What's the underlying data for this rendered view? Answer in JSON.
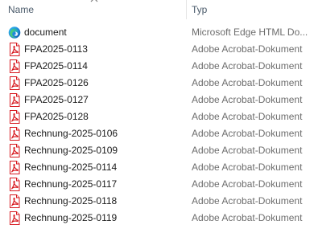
{
  "columns": {
    "name": "Name",
    "type": "Typ"
  },
  "files": [
    {
      "name": "document",
      "type": "Microsoft Edge HTML Do...",
      "icon": "edge-icon"
    },
    {
      "name": "FPA2025-0113",
      "type": "Adobe Acrobat-Dokument",
      "icon": "pdf-icon"
    },
    {
      "name": "FPA2025-0114",
      "type": "Adobe Acrobat-Dokument",
      "icon": "pdf-icon"
    },
    {
      "name": "FPA2025-0126",
      "type": "Adobe Acrobat-Dokument",
      "icon": "pdf-icon"
    },
    {
      "name": "FPA2025-0127",
      "type": "Adobe Acrobat-Dokument",
      "icon": "pdf-icon"
    },
    {
      "name": "FPA2025-0128",
      "type": "Adobe Acrobat-Dokument",
      "icon": "pdf-icon"
    },
    {
      "name": "Rechnung-2025-0106",
      "type": "Adobe Acrobat-Dokument",
      "icon": "pdf-icon"
    },
    {
      "name": "Rechnung-2025-0109",
      "type": "Adobe Acrobat-Dokument",
      "icon": "pdf-icon"
    },
    {
      "name": "Rechnung-2025-0114",
      "type": "Adobe Acrobat-Dokument",
      "icon": "pdf-icon"
    },
    {
      "name": "Rechnung-2025-0117",
      "type": "Adobe Acrobat-Dokument",
      "icon": "pdf-icon"
    },
    {
      "name": "Rechnung-2025-0118",
      "type": "Adobe Acrobat-Dokument",
      "icon": "pdf-icon"
    },
    {
      "name": "Rechnung-2025-0119",
      "type": "Adobe Acrobat-Dokument",
      "icon": "pdf-icon"
    }
  ],
  "colors": {
    "pdf_red": "#d7191f",
    "header_text": "#4a5a6a",
    "type_text": "#6d6d6d",
    "name_text": "#1a1a1a"
  }
}
